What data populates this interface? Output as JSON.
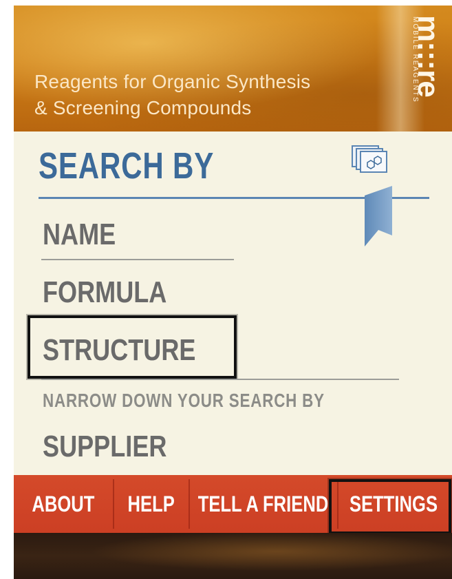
{
  "header": {
    "tagline_line1": "Reagents for Organic Synthesis",
    "tagline_line2": "& Screening Compounds",
    "logo_main": "m:::re",
    "logo_sub": "MOBILE REAGENTS"
  },
  "search": {
    "title": "SEARCH BY",
    "options": {
      "name": "NAME",
      "formula": "FORMULA",
      "structure": "STRUCTURE"
    },
    "narrow_label": "NARROW DOWN YOUR SEARCH BY",
    "supplier": "SUPPLIER",
    "icons": {
      "structure_drawing": "structure-stack-icon",
      "bookmark": "bookmark-icon"
    }
  },
  "nav": {
    "items": [
      "ABOUT",
      "HELP",
      "TELL A FRIEND",
      "SETTINGS"
    ]
  },
  "colors": {
    "header_orange": "#cf7f18",
    "title_blue": "#3c6a99",
    "nav_red": "#cc3f24",
    "menu_gray": "#6a6a6a",
    "background": "#f6f3e3"
  }
}
